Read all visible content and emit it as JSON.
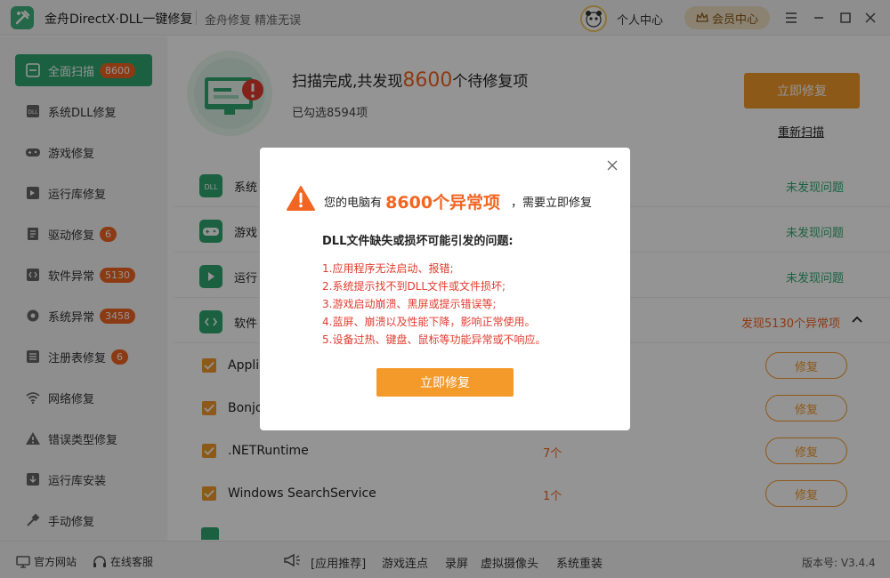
{
  "titlebar": {
    "app_title": "金舟DirectX·DLL一键修复",
    "slogan": "金舟修复 精准无误",
    "personal_center": "个人中心",
    "vip_center": "会员中心"
  },
  "sidebar": {
    "items": [
      {
        "label": "全面扫描",
        "badge": "8600",
        "icon": "scan-icon",
        "active": true
      },
      {
        "label": "系统DLL修复",
        "badge": "",
        "icon": "dll-icon"
      },
      {
        "label": "游戏修复",
        "badge": "",
        "icon": "gamepad-icon"
      },
      {
        "label": "运行库修复",
        "badge": "",
        "icon": "runtime-icon"
      },
      {
        "label": "驱动修复",
        "badge": "6",
        "icon": "driver-icon"
      },
      {
        "label": "软件异常",
        "badge": "5130",
        "icon": "code-icon"
      },
      {
        "label": "系统异常",
        "badge": "3458",
        "icon": "gear-icon"
      },
      {
        "label": "注册表修复",
        "badge": "6",
        "icon": "registry-icon"
      },
      {
        "label": "网络修复",
        "badge": "",
        "icon": "wifi-icon"
      },
      {
        "label": "错误类型修复",
        "badge": "",
        "icon": "warning-icon"
      },
      {
        "label": "运行库安装",
        "badge": "",
        "icon": "install-icon"
      },
      {
        "label": "手动修复",
        "badge": "",
        "icon": "wrench-icon"
      }
    ]
  },
  "scan": {
    "title_prefix": "扫描完成,共发现",
    "count": "8600",
    "title_suffix": "个待修复项",
    "selected": "已勾选8594项",
    "fix_now": "立即修复",
    "rescan": "重新扫描"
  },
  "categories": [
    {
      "label": "系统",
      "status": "未发现问题",
      "icon": "dll-icon"
    },
    {
      "label": "游戏",
      "status": "未发现问题",
      "icon": "gamepad-icon"
    },
    {
      "label": "运行",
      "status": "未发现问题",
      "icon": "runtime-icon"
    },
    {
      "label": "软件",
      "status": "发现5130个异常项",
      "icon": "code-icon"
    }
  ],
  "subitems": [
    {
      "label": "Appli",
      "count": "",
      "button": "修复"
    },
    {
      "label": "Bonjo",
      "count": "",
      "button": "修复"
    },
    {
      "label": ".NETRuntime",
      "count": "7个",
      "button": "修复"
    },
    {
      "label": "Windows SearchService",
      "count": "1个",
      "button": "修复"
    }
  ],
  "bottombar": {
    "official_site": "官方网站",
    "online_service": "在线客服",
    "app_recommend": "[应用推荐]",
    "links": [
      "游戏连点",
      "录屏",
      "虚拟摄像头",
      "系统重装"
    ],
    "version": "版本号: V3.4.4"
  },
  "dialog": {
    "head_prefix": "您的电脑有",
    "head_count": "8600个异常项",
    "head_suffix": "，需要立即修复",
    "subtitle": "DLL文件缺失或损坏可能引发的问题:",
    "problems": [
      "1.应用程序无法启动、报错;",
      "2.系统提示找不到DLL文件或文件损坏;",
      "3.游戏启动崩溃、黑屏或提示错误等;",
      "4.蓝屏、崩溃以及性能下降，影响正常使用。",
      "5.设备过热、键盘、鼠标等功能异常或不响应。"
    ],
    "button": "立即修复"
  },
  "colors": {
    "brand_green": "#2fa870",
    "accent_orange": "#f39a2b",
    "alert_red": "#e23b2e",
    "highlight_orange": "#f26522"
  }
}
